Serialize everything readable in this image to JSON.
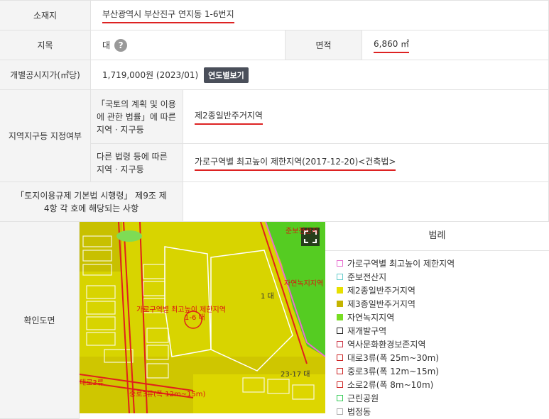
{
  "rows": {
    "location": {
      "label": "소재지",
      "value": "부산광역시 부산진구 연지동 1-6번지"
    },
    "land_category": {
      "label": "지목",
      "value": "대",
      "question_icon": "?"
    },
    "area": {
      "label": "면적",
      "value": "6,860 ㎡"
    },
    "official_price": {
      "label": "개별공시지가(㎡당)",
      "value": "1,719,000원 (2023/01)",
      "button": "연도별보기"
    },
    "zoning": {
      "label": "지역지구등 지정여부",
      "sub1_label": "「국토의 계획 및 이용에 관한 법률」에 따른 지역 · 지구등",
      "sub1_value": "제2종일반주거지역",
      "sub2_label": "다른 법령 등에 따른 지역 · 지구등",
      "sub2_value": "가로구역별 최고높이 제한지역(2017-12-20)<건축법>"
    },
    "regulation": {
      "label": "「토지이용규제 기본법 시행령」 제9조 제4항 각 호에 해당되는 사항",
      "value": ""
    },
    "map_confirm": {
      "label": "확인도면"
    }
  },
  "map": {
    "labels": {
      "center_zone": "가로구역별 최고높이 제한지역",
      "center_parcel": "1-6 대",
      "parcel_1": "1 대",
      "parcel_2317": "23-17 대",
      "top_right": "준보전산지",
      "park_text": "자연녹지지역",
      "road_bottom": "중로3류(폭 12m~15m)",
      "road_left": "대로3류"
    }
  },
  "legend": {
    "title": "범례",
    "items": [
      {
        "label": "가로구역별 최고높이 제한지역",
        "color": "#e86ed0"
      },
      {
        "label": "준보전산지",
        "color": "#66cccc"
      },
      {
        "label": "제2종일반주거지역",
        "color": "#e7e000",
        "filled": true
      },
      {
        "label": "제3종일반주거지역",
        "color": "#c4b400",
        "filled": true
      },
      {
        "label": "자연녹지지역",
        "color": "#77dd22",
        "filled": true
      },
      {
        "label": "재개발구역",
        "color": "#222222"
      },
      {
        "label": "역사문화환경보존지역",
        "color": "#cc3344"
      },
      {
        "label": "대로3류(폭 25m~30m)",
        "color": "#cc2222"
      },
      {
        "label": "중로3류(폭 12m~15m)",
        "color": "#cc2222"
      },
      {
        "label": "소로2류(폭 8m~10m)",
        "color": "#cc2222"
      },
      {
        "label": "근린공원",
        "color": "#33cc55"
      },
      {
        "label": "법정동",
        "color": "#aaaaaa"
      }
    ]
  }
}
